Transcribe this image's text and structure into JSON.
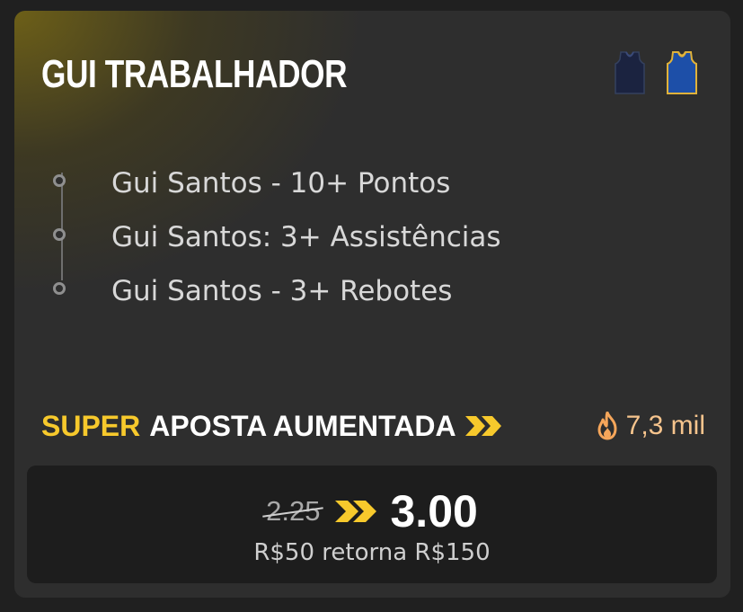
{
  "bet": {
    "title": "GUI TRABALHADOR",
    "legs": [
      {
        "label": "Gui Santos - 10+ Pontos"
      },
      {
        "label": "Gui Santos: 3+ Assistências"
      },
      {
        "label": "Gui Santos - 3+ Rebotes"
      }
    ],
    "teams": [
      {
        "icon": "navy-jersey-icon",
        "color": "#1b2340"
      },
      {
        "icon": "blue-gold-jersey-icon",
        "color": "#1d4fa8"
      }
    ]
  },
  "promo": {
    "super": "SUPER",
    "label": "APOSTA AUMENTADA",
    "accent": "#f7c92c",
    "popularity": "7,3 mil",
    "popularity_icon": "fire-icon"
  },
  "odds": {
    "old": "2.25",
    "new": "3.00",
    "returns": "R$50 retorna R$150"
  }
}
